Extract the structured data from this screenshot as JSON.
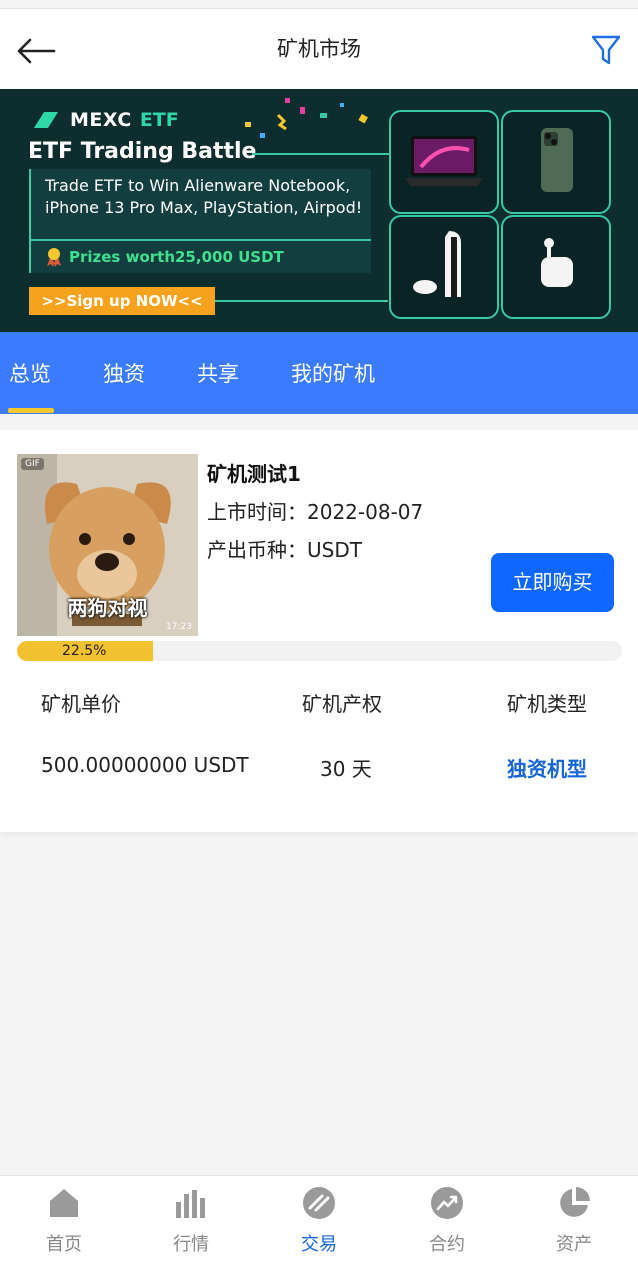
{
  "header": {
    "title": "矿机市场"
  },
  "banner": {
    "brand": "MEXC",
    "brand_suffix": "ETF",
    "headline": "ETF Trading Battle",
    "description": "Trade ETF to Win Alienware Notebook, iPhone 13 Pro Max, PlayStation, Airpod!",
    "prize": "Prizes worth25,000 USDT",
    "signup": ">>Sign up NOW<<"
  },
  "tabs": [
    {
      "label": "总览",
      "active": true
    },
    {
      "label": "独资"
    },
    {
      "label": "共享"
    },
    {
      "label": "我的矿机"
    }
  ],
  "miner": {
    "image_caption": "两狗对视",
    "image_tag": "GIF",
    "image_time": "17:23",
    "name": "矿机测试1",
    "listed_label": "上市时间：",
    "listed_value": "2022-08-07",
    "coin_label": "产出币种：",
    "coin_value": "USDT",
    "buy_label": "立即购买",
    "progress_percent": 22.5,
    "progress_label": "22.5%",
    "headers": {
      "price": "矿机单价",
      "term": "矿机产权",
      "type": "矿机类型"
    },
    "values": {
      "price": "500.00000000 USDT",
      "term": "30 天",
      "type": "独资机型"
    }
  },
  "bottom_nav": [
    {
      "label": "首页",
      "icon": "home-icon"
    },
    {
      "label": "行情",
      "icon": "market-bars-icon"
    },
    {
      "label": "交易",
      "icon": "trade-icon",
      "active": true
    },
    {
      "label": "合约",
      "icon": "contract-trend-icon"
    },
    {
      "label": "资产",
      "icon": "assets-pie-icon"
    }
  ],
  "colors": {
    "primary": "#3a7bff",
    "buy_button": "#0f67ff",
    "accent_yellow": "#f2c12f",
    "active_text": "#1565d8"
  }
}
